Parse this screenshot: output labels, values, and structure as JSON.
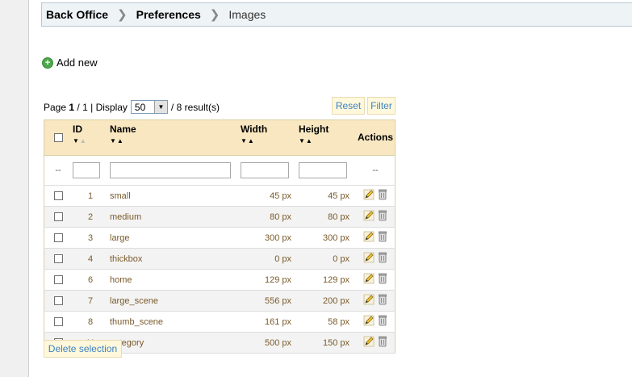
{
  "breadcrumb": {
    "items": [
      "Back Office",
      "Preferences",
      "Images"
    ],
    "separator": "❯"
  },
  "add_new": {
    "label": "Add new",
    "icon": "plus-circle-icon"
  },
  "paging": {
    "page_label": "Page",
    "current": "1",
    "sep": "/",
    "total": "1",
    "display_label": "| Display",
    "per_page": "50",
    "results": "/ 8 result(s)"
  },
  "buttons": {
    "reset": "Reset",
    "filter": "Filter",
    "delete_selection": "Delete selection"
  },
  "table": {
    "columns": {
      "id": "ID",
      "name": "Name",
      "width": "Width",
      "height": "Height",
      "actions": "Actions"
    },
    "filter_row": {
      "id_dash": "--",
      "actions_dash": "--"
    },
    "rows": [
      {
        "id": "1",
        "name": "small",
        "width": "45 px",
        "height": "45 px"
      },
      {
        "id": "2",
        "name": "medium",
        "width": "80 px",
        "height": "80 px"
      },
      {
        "id": "3",
        "name": "large",
        "width": "300 px",
        "height": "300 px"
      },
      {
        "id": "4",
        "name": "thickbox",
        "width": "0 px",
        "height": "0 px"
      },
      {
        "id": "6",
        "name": "home",
        "width": "129 px",
        "height": "129 px"
      },
      {
        "id": "7",
        "name": "large_scene",
        "width": "556 px",
        "height": "200 px"
      },
      {
        "id": "8",
        "name": "thumb_scene",
        "width": "161 px",
        "height": "58 px"
      },
      {
        "id": "11",
        "name": "category",
        "width": "500 px",
        "height": "150 px"
      }
    ]
  },
  "colors": {
    "header_bg": "#f8e7c0",
    "breadcrumb_bg": "#eef3f5",
    "link_blue": "#3b82c4",
    "row_text": "#7a5a2a"
  }
}
